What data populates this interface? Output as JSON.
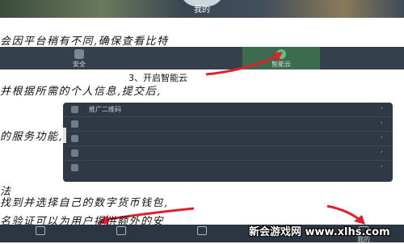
{
  "header": {
    "tab_label": "我的"
  },
  "nav": {
    "items": [
      {
        "label": "安全"
      },
      {
        "label": ""
      },
      {
        "label": ""
      },
      {
        "label": "智能云",
        "active": true
      },
      {
        "label": ""
      }
    ]
  },
  "callout": {
    "step_label": "3、开启智能云"
  },
  "handwriting": {
    "line1": "会因平台稍有不同,确保查看比特",
    "line2": "并根据所需的个人信息,提交后,",
    "line3": "的服务功能,",
    "line4": "法",
    "line5": "找到并选择自己的数字货币钱包,",
    "line6": "名验证可以为用户提供额外的安"
  },
  "menu": {
    "items": [
      {
        "label": "推广二维码"
      },
      {
        "label": ""
      },
      {
        "label": ""
      },
      {
        "label": ""
      },
      {
        "label": ""
      }
    ]
  },
  "bottom_nav": {
    "items": [
      {
        "label": ""
      },
      {
        "label": ""
      },
      {
        "label": ""
      },
      {
        "label": "我的"
      },
      {
        "label": ""
      }
    ]
  },
  "watermark": {
    "text": "新会游戏网 www.xlhs.com"
  },
  "colors": {
    "panel": "#2f3a46",
    "accent_green": "#3d6b4d",
    "arrow_red": "#e0202a"
  }
}
